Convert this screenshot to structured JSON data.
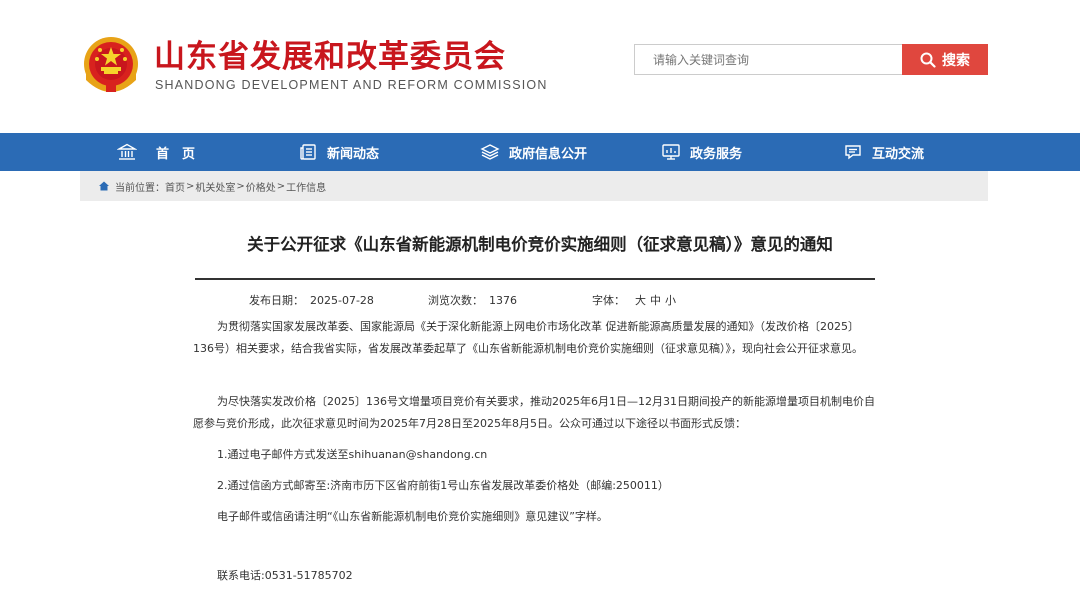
{
  "header": {
    "org_name_cn": "山东省发展和改革委员会",
    "org_name_en": "SHANDONG DEVELOPMENT AND REFORM COMMISSION",
    "search": {
      "placeholder": "请输入关键词查询",
      "button_label": "搜索"
    }
  },
  "nav": {
    "items": [
      {
        "label": "首　页",
        "icon": "building-icon"
      },
      {
        "label": "新闻动态",
        "icon": "news-icon"
      },
      {
        "label": "政府信息公开",
        "icon": "layers-icon"
      },
      {
        "label": "政务服务",
        "icon": "chart-icon"
      },
      {
        "label": "互动交流",
        "icon": "chat-icon"
      }
    ]
  },
  "breadcrumb": {
    "prefix": "当前位置：",
    "items": [
      "首页",
      "机关处室",
      "价格处",
      "工作信息"
    ],
    "separator": ">"
  },
  "article": {
    "title": "关于公开征求《山东省新能源机制电价竞价实施细则（征求意见稿）》意见的通知",
    "meta": {
      "date_label": "发布日期：",
      "date": "2025-07-28",
      "views_label": "浏览次数：",
      "views": "1376",
      "font_label": "字体：",
      "font_sizes": [
        "大",
        "中",
        "小"
      ]
    },
    "paragraphs": [
      "为贯彻落实国家发展改革委、国家能源局《关于深化新能源上网电价市场化改革 促进新能源高质量发展的通知》（发改价格〔2025〕136号）相关要求，结合我省实际，省发展改革委起草了《山东省新能源机制电价竞价实施细则（征求意见稿）》，现向社会公开征求意见。",
      "为尽快落实发改价格〔2025〕136号文增量项目竞价有关要求，推动2025年6月1日—12月31日期间投产的新能源增量项目机制电价自愿参与竞价形成，此次征求意见时间为2025年7月28日至2025年8月5日。公众可通过以下途径以书面形式反馈："
    ],
    "lines": [
      "1.通过电子邮件方式发送至shihuanan@shandong.cn",
      "2.通过信函方式邮寄至:济南市历下区省府前街1号山东省发展改革委价格处（邮编:250011）",
      "电子邮件或信函请注明“《山东省新能源机制电价竞价实施细则》意见建议”字样。"
    ],
    "contact": "联系电话:0531-51785702"
  },
  "colors": {
    "brand_red": "#c8161d",
    "nav_blue": "#2b6bb5",
    "search_button": "#e0473e",
    "breadcrumb_bg": "#ececec"
  }
}
